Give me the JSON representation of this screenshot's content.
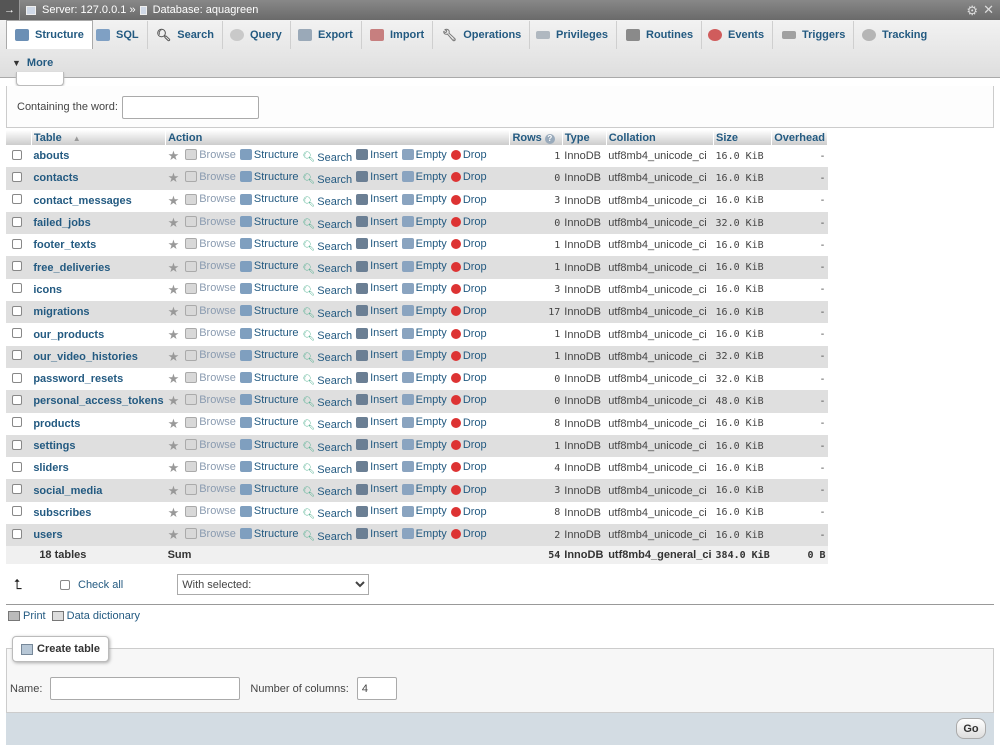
{
  "breadcrumb": {
    "server_label": "Server: 127.0.0.1 »",
    "database_label": "Database: aquagreen"
  },
  "tabs": [
    {
      "label": "Structure",
      "icon": "structure-icon",
      "active": true
    },
    {
      "label": "SQL",
      "icon": "sql-icon"
    },
    {
      "label": "Search",
      "icon": "search-icon"
    },
    {
      "label": "Query",
      "icon": "query-icon"
    },
    {
      "label": "Export",
      "icon": "export-icon"
    },
    {
      "label": "Import",
      "icon": "import-icon"
    },
    {
      "label": "Operations",
      "icon": "wrench-icon"
    },
    {
      "label": "Privileges",
      "icon": "privileges-icon"
    },
    {
      "label": "Routines",
      "icon": "routines-icon"
    },
    {
      "label": "Events",
      "icon": "events-icon"
    },
    {
      "label": "Triggers",
      "icon": "triggers-icon"
    },
    {
      "label": "Tracking",
      "icon": "tracking-icon"
    }
  ],
  "more_label": "More",
  "filter": {
    "label": "Containing the word:",
    "value": ""
  },
  "table_headers": {
    "table": "Table",
    "action": "Action",
    "rows": "Rows",
    "type": "Type",
    "collation": "Collation",
    "size": "Size",
    "overhead": "Overhead"
  },
  "actions": {
    "browse": "Browse",
    "structure": "Structure",
    "search": "Search",
    "insert": "Insert",
    "empty": "Empty",
    "drop": "Drop"
  },
  "rows": [
    {
      "name": "abouts",
      "rows": "1",
      "type": "InnoDB",
      "collation": "utf8mb4_unicode_ci",
      "size": "16.0 KiB",
      "overhead": "-"
    },
    {
      "name": "contacts",
      "rows": "0",
      "type": "InnoDB",
      "collation": "utf8mb4_unicode_ci",
      "size": "16.0 KiB",
      "overhead": "-"
    },
    {
      "name": "contact_messages",
      "rows": "3",
      "type": "InnoDB",
      "collation": "utf8mb4_unicode_ci",
      "size": "16.0 KiB",
      "overhead": "-"
    },
    {
      "name": "failed_jobs",
      "rows": "0",
      "type": "InnoDB",
      "collation": "utf8mb4_unicode_ci",
      "size": "32.0 KiB",
      "overhead": "-"
    },
    {
      "name": "footer_texts",
      "rows": "1",
      "type": "InnoDB",
      "collation": "utf8mb4_unicode_ci",
      "size": "16.0 KiB",
      "overhead": "-"
    },
    {
      "name": "free_deliveries",
      "rows": "1",
      "type": "InnoDB",
      "collation": "utf8mb4_unicode_ci",
      "size": "16.0 KiB",
      "overhead": "-"
    },
    {
      "name": "icons",
      "rows": "3",
      "type": "InnoDB",
      "collation": "utf8mb4_unicode_ci",
      "size": "16.0 KiB",
      "overhead": "-"
    },
    {
      "name": "migrations",
      "rows": "17",
      "type": "InnoDB",
      "collation": "utf8mb4_unicode_ci",
      "size": "16.0 KiB",
      "overhead": "-"
    },
    {
      "name": "our_products",
      "rows": "1",
      "type": "InnoDB",
      "collation": "utf8mb4_unicode_ci",
      "size": "16.0 KiB",
      "overhead": "-"
    },
    {
      "name": "our_video_histories",
      "rows": "1",
      "type": "InnoDB",
      "collation": "utf8mb4_unicode_ci",
      "size": "32.0 KiB",
      "overhead": "-"
    },
    {
      "name": "password_resets",
      "rows": "0",
      "type": "InnoDB",
      "collation": "utf8mb4_unicode_ci",
      "size": "32.0 KiB",
      "overhead": "-"
    },
    {
      "name": "personal_access_tokens",
      "rows": "0",
      "type": "InnoDB",
      "collation": "utf8mb4_unicode_ci",
      "size": "48.0 KiB",
      "overhead": "-"
    },
    {
      "name": "products",
      "rows": "8",
      "type": "InnoDB",
      "collation": "utf8mb4_unicode_ci",
      "size": "16.0 KiB",
      "overhead": "-"
    },
    {
      "name": "settings",
      "rows": "1",
      "type": "InnoDB",
      "collation": "utf8mb4_unicode_ci",
      "size": "16.0 KiB",
      "overhead": "-"
    },
    {
      "name": "sliders",
      "rows": "4",
      "type": "InnoDB",
      "collation": "utf8mb4_unicode_ci",
      "size": "16.0 KiB",
      "overhead": "-"
    },
    {
      "name": "social_media",
      "rows": "3",
      "type": "InnoDB",
      "collation": "utf8mb4_unicode_ci",
      "size": "16.0 KiB",
      "overhead": "-"
    },
    {
      "name": "subscribes",
      "rows": "8",
      "type": "InnoDB",
      "collation": "utf8mb4_unicode_ci",
      "size": "16.0 KiB",
      "overhead": "-"
    },
    {
      "name": "users",
      "rows": "2",
      "type": "InnoDB",
      "collation": "utf8mb4_unicode_ci",
      "size": "16.0 KiB",
      "overhead": "-"
    }
  ],
  "summary": {
    "tables": "18 tables",
    "action": "Sum",
    "rows": "54",
    "type": "InnoDB",
    "collation": "utf8mb4_general_ci",
    "size": "384.0 KiB",
    "overhead": "0 B"
  },
  "bulk": {
    "check_all": "Check all",
    "with_selected": "With selected:"
  },
  "links": {
    "print": "Print",
    "data_dictionary": "Data dictionary"
  },
  "create_table": {
    "legend": "Create table",
    "name_label": "Name:",
    "name_value": "",
    "columns_label": "Number of columns:",
    "columns_value": "4",
    "go": "Go"
  },
  "colors": {
    "link": "#235a81",
    "drop": "#dd3333",
    "row_alt": "#dfdfdf"
  }
}
